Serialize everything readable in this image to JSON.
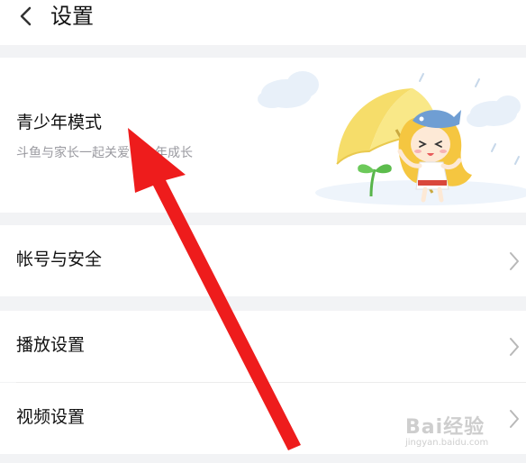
{
  "header": {
    "title": "设置",
    "back_icon": "chevron-left-icon"
  },
  "teen_mode": {
    "title": "青少年模式",
    "description": "斗鱼与家长一起关爱青少年成长"
  },
  "settings": [
    {
      "label": "帐号与安全",
      "icon": "chevron-right-icon"
    },
    {
      "label": "播放设置",
      "icon": "chevron-right-icon"
    },
    {
      "label": "视频设置",
      "icon": "chevron-right-icon"
    }
  ],
  "watermark": {
    "main": "Bai经验",
    "sub": "jingyan.baidu.com"
  },
  "colors": {
    "page_bg": "#f2f3f5",
    "card_bg": "#ffffff",
    "annotation_arrow": "#ee1c1c",
    "umbrella": "#f6dd6a",
    "character_hair": "#f5c640"
  }
}
